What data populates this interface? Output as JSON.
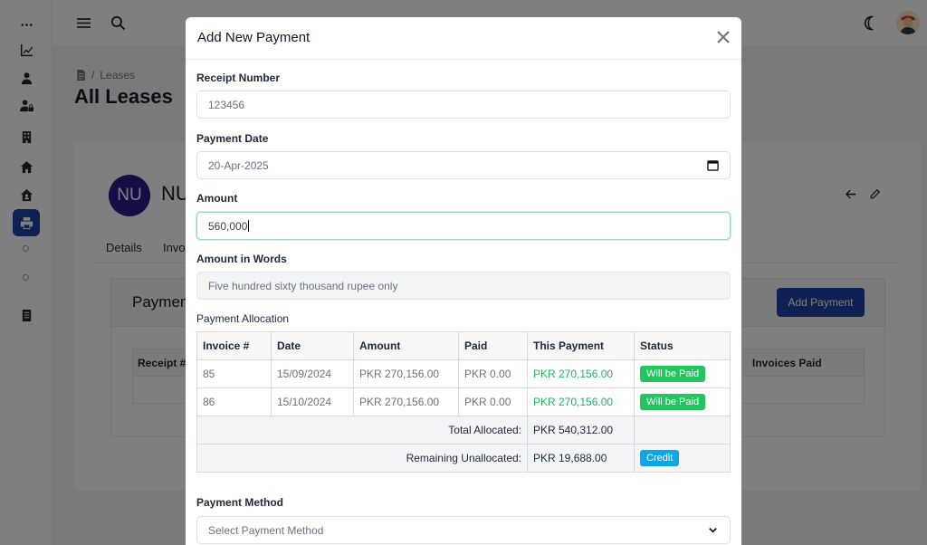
{
  "app": {
    "breadcrumb_section": "Leases",
    "page_title": "All Leases",
    "tenant_initials": "NU",
    "tenant_name_partial": "NU",
    "tabs": [
      {
        "label": "Details"
      },
      {
        "label": "Invo"
      }
    ],
    "payments_panel_title": "Paymen",
    "add_payment_button": "Add Payment",
    "table_headers": [
      {
        "label": "Receipt #"
      },
      {
        "label": "Invoices Paid"
      }
    ]
  },
  "sidebar": {
    "items": [
      {
        "icon": "ellipsis-icon"
      },
      {
        "icon": "chart-line-icon"
      },
      {
        "icon": "user-icon"
      },
      {
        "icon": "user-lock-icon"
      },
      {
        "icon": "building-icon"
      },
      {
        "icon": "home-icon"
      },
      {
        "icon": "house-user-icon"
      },
      {
        "icon": "print-icon",
        "active": true
      },
      {
        "icon": "circle-icon"
      },
      {
        "icon": "circle-icon"
      },
      {
        "icon": "file-icon"
      }
    ]
  },
  "modal": {
    "title": "Add New Payment",
    "receipt": {
      "label": "Receipt Number",
      "value": "123456"
    },
    "payment_date": {
      "label": "Payment Date",
      "value": "20-Apr-2025"
    },
    "amount": {
      "label": "Amount",
      "value": "560,000"
    },
    "amount_words": {
      "label": "Amount in Words",
      "value": "Five hundred sixty thousand rupee only"
    },
    "allocation": {
      "label": "Payment Allocation",
      "headers": [
        "Invoice #",
        "Date",
        "Amount",
        "Paid",
        "This Payment",
        "Status"
      ],
      "rows": [
        {
          "invoice": "85",
          "date": "15/09/2024",
          "amount": "PKR 270,156.00",
          "paid": "PKR 0.00",
          "this_payment": "PKR 270,156.00",
          "status": "Will be Paid"
        },
        {
          "invoice": "86",
          "date": "15/10/2024",
          "amount": "PKR 270,156.00",
          "paid": "PKR 0.00",
          "this_payment": "PKR 270,156.00",
          "status": "Will be Paid"
        }
      ],
      "total_label": "Total Allocated:",
      "total_value": "PKR 540,312.00",
      "remaining_label": "Remaining Unallocated:",
      "remaining_value": "PKR 19,688.00",
      "remaining_status": "Credit"
    },
    "payment_method": {
      "label": "Payment Method",
      "placeholder": "Select Payment Method"
    }
  },
  "colors": {
    "primary": "#1e40a8",
    "success": "#22c55e",
    "info": "#0ea5e9"
  }
}
